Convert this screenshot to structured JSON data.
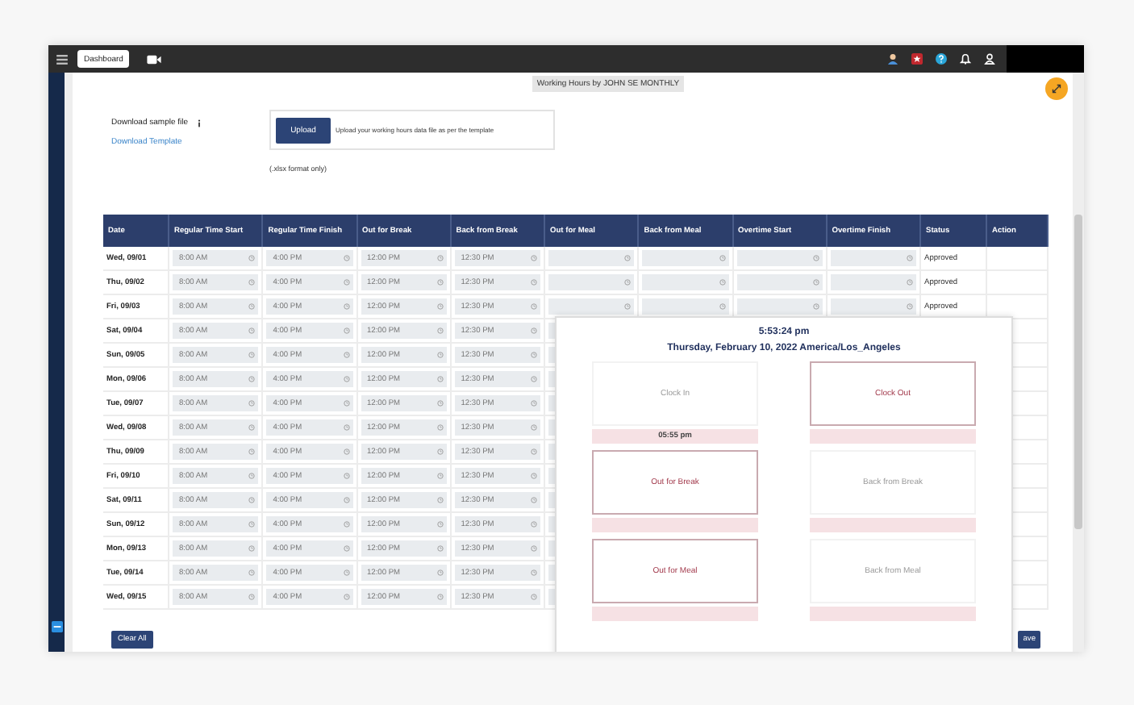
{
  "topbar": {
    "tab": "Dashboard"
  },
  "page_title": "Working Hours by JOHN SE MONTHLY",
  "download": {
    "label": "Download sample file",
    "link": "Download Template"
  },
  "upload": {
    "button": "Upload",
    "hint": "Upload your working hours data file as per the template",
    "note": "(.xlsx format only)"
  },
  "table": {
    "columns": [
      "Date",
      "Regular Time Start",
      "Regular Time Finish",
      "Out for Break",
      "Back from Break",
      "Out for Meal",
      "Back from Meal",
      "Overtime Start",
      "Overtime Finish",
      "Status",
      "Action"
    ],
    "rows": [
      {
        "date": "Wed, 09/01",
        "times": [
          "8:00 AM",
          "4:00 PM",
          "12:00 PM",
          "12:30 PM"
        ],
        "status": "Approved"
      },
      {
        "date": "Thu, 09/02",
        "times": [
          "8:00 AM",
          "4:00 PM",
          "12:00 PM",
          "12:30 PM"
        ],
        "status": "Approved"
      },
      {
        "date": "Fri, 09/03",
        "times": [
          "8:00 AM",
          "4:00 PM",
          "12:00 PM",
          "12:30 PM"
        ],
        "status": "Approved"
      },
      {
        "date": "Sat, 09/04",
        "times": [
          "8:00 AM",
          "4:00 PM",
          "12:00 PM",
          "12:30 PM"
        ]
      },
      {
        "date": "Sun, 09/05",
        "times": [
          "8:00 AM",
          "4:00 PM",
          "12:00 PM",
          "12:30 PM"
        ]
      },
      {
        "date": "Mon, 09/06",
        "times": [
          "8:00 AM",
          "4:00 PM",
          "12:00 PM",
          "12:30 PM"
        ]
      },
      {
        "date": "Tue, 09/07",
        "times": [
          "8:00 AM",
          "4:00 PM",
          "12:00 PM",
          "12:30 PM"
        ]
      },
      {
        "date": "Wed, 09/08",
        "times": [
          "8:00 AM",
          "4:00 PM",
          "12:00 PM",
          "12:30 PM"
        ]
      },
      {
        "date": "Thu, 09/09",
        "times": [
          "8:00 AM",
          "4:00 PM",
          "12:00 PM",
          "12:30 PM"
        ]
      },
      {
        "date": "Fri, 09/10",
        "times": [
          "8:00 AM",
          "4:00 PM",
          "12:00 PM",
          "12:30 PM"
        ]
      },
      {
        "date": "Sat, 09/11",
        "times": [
          "8:00 AM",
          "4:00 PM",
          "12:00 PM",
          "12:30 PM"
        ]
      },
      {
        "date": "Sun, 09/12",
        "times": [
          "8:00 AM",
          "4:00 PM",
          "12:00 PM",
          "12:30 PM"
        ]
      },
      {
        "date": "Mon, 09/13",
        "times": [
          "8:00 AM",
          "4:00 PM",
          "12:00 PM",
          "12:30 PM"
        ]
      },
      {
        "date": "Tue, 09/14",
        "times": [
          "8:00 AM",
          "4:00 PM",
          "12:00 PM",
          "12:30 PM"
        ]
      },
      {
        "date": "Wed, 09/15",
        "times": [
          "8:00 AM",
          "4:00 PM",
          "12:00 PM",
          "12:30 PM"
        ]
      }
    ]
  },
  "buttons": {
    "clear": "Clear All",
    "save": "ave"
  },
  "clock": {
    "time": "5:53:24 pm",
    "date": "Thursday, February 10, 2022 America/Los_Angeles",
    "punches": [
      {
        "label": "Clock In",
        "enabled": false,
        "time": "05:55 pm"
      },
      {
        "label": "Clock Out",
        "enabled": true
      },
      {
        "label": "Out for Break",
        "enabled": true
      },
      {
        "label": "Back from Break",
        "enabled": false
      },
      {
        "label": "Out for Meal",
        "enabled": true
      },
      {
        "label": "Back from Meal",
        "enabled": false
      }
    ]
  }
}
